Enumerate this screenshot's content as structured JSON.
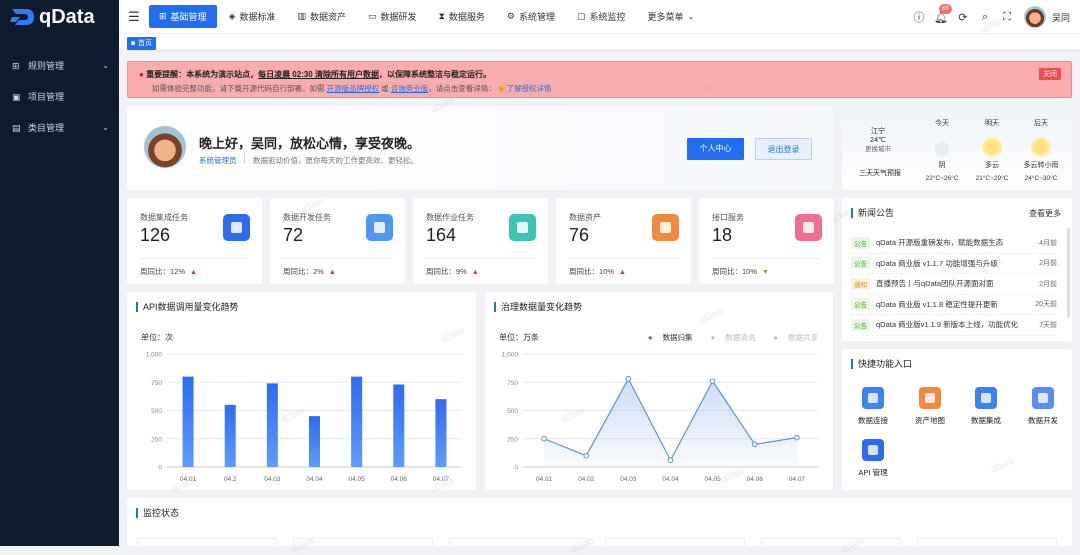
{
  "app": {
    "name": "qData"
  },
  "sidebar": {
    "items": [
      {
        "label": "规则管理",
        "icon": "grid-icon",
        "expandable": true
      },
      {
        "label": "项目管理",
        "icon": "folder-icon",
        "expandable": false
      },
      {
        "label": "类目管理",
        "icon": "category-icon",
        "expandable": true
      }
    ]
  },
  "topnav": {
    "items": [
      {
        "label": "基础管理",
        "icon": "grid-icon",
        "active": true
      },
      {
        "label": "数据标准",
        "icon": "layers-icon",
        "active": false
      },
      {
        "label": "数据资产",
        "icon": "chart-icon",
        "active": false
      },
      {
        "label": "数据研发",
        "icon": "window-icon",
        "active": false
      },
      {
        "label": "数据服务",
        "icon": "hourglass-icon",
        "active": false
      },
      {
        "label": "系统管理",
        "icon": "gear-icon",
        "active": false
      },
      {
        "label": "系统监控",
        "icon": "monitor-icon",
        "active": false
      },
      {
        "label": "更多菜单",
        "icon": "chevron-down-icon",
        "active": false
      }
    ],
    "notification_count": "68",
    "username": "吴同"
  },
  "tags": {
    "home": "首页"
  },
  "alert": {
    "title": "重要提醒：",
    "text": "本系统为演示站点，",
    "strong": "每日凌晨 02:30 清除所有用户数据",
    "text2": "，以保障系统整洁与稳定运行。",
    "line2a": "如需体验完整功能，请下载开源代码自行部署。如需",
    "link1": "开源版品牌授权",
    "or": " 或 ",
    "link2": "咨询商业版",
    "line2b": "，请点击查看详情：",
    "link3": "了解授权详情",
    "close": "关闭"
  },
  "welcome": {
    "greeting": "晚上好，吴同，放松心情，享受夜晚。",
    "role": "系统管理员",
    "motto": "数据驱动价值，愿你每天的工作更高效、更轻松。",
    "btn_profile": "个人中心",
    "btn_logout": "退出登录"
  },
  "weather": {
    "city": "江宁",
    "current_temp": "24℃",
    "switch_city": "更换城市",
    "forecast_title": "三天天气预报",
    "days": [
      {
        "day": "今天",
        "cond": "阴",
        "temp": "22°C~26°C",
        "icon": "cloud-icon"
      },
      {
        "day": "明天",
        "cond": "多云",
        "temp": "21°C~29°C",
        "icon": "sun-icon"
      },
      {
        "day": "后天",
        "cond": "多云转小雨",
        "temp": "24°C~30°C",
        "icon": "sun-icon"
      }
    ]
  },
  "stats": [
    {
      "label": "数据集成任务",
      "value": "126",
      "foot": "周同比：",
      "change": "12%",
      "trend": "up",
      "color": "#2f6bf0"
    },
    {
      "label": "数据开发任务",
      "value": "72",
      "foot": "周同比：",
      "change": "2%",
      "trend": "up",
      "color": "#4f97f2"
    },
    {
      "label": "数据作业任务",
      "value": "164",
      "foot": "周同比：",
      "change": "9%",
      "trend": "up",
      "color": "#3cc5b6"
    },
    {
      "label": "数据资产",
      "value": "76",
      "foot": "周同比：",
      "change": "10%",
      "trend": "up",
      "color": "#f08a3e"
    },
    {
      "label": "接口服务",
      "value": "18",
      "foot": "周同比：",
      "change": "10%",
      "trend": "down",
      "color": "#f26d8f"
    }
  ],
  "news": {
    "title": "新闻公告",
    "more": "查看更多",
    "items": [
      {
        "tag": "公告",
        "tag_type": "g",
        "title": "qData 开源版重磅发布，赋能数据生态",
        "date": "4月前"
      },
      {
        "tag": "公告",
        "tag_type": "g",
        "title": "qData 商业版 v1.1.7 功能增强与升级",
        "date": "2月前"
      },
      {
        "tag": "通知",
        "tag_type": "o",
        "title": "直播预告丨与qData团队开源面对面",
        "date": "2月前"
      },
      {
        "tag": "公告",
        "tag_type": "g",
        "title": "qData 商业版 v1.1.8 稳定性提升更新",
        "date": "20天前"
      },
      {
        "tag": "公告",
        "tag_type": "g",
        "title": "qData 商业版v1.1.9 新版本上线，功能优化",
        "date": "7天前"
      }
    ]
  },
  "quick": {
    "title": "快捷功能入口",
    "items": [
      {
        "label": "数据连接",
        "color": "#3b82f6"
      },
      {
        "label": "资产地图",
        "color": "#f08a3e"
      },
      {
        "label": "数据集成",
        "color": "#3b82f6"
      },
      {
        "label": "数据开发",
        "color": "#5b8def"
      },
      {
        "label": "API 管理",
        "color": "#2f6bf0"
      }
    ]
  },
  "chart_api": {
    "title": "API数据调用量变化趋势",
    "unit": "单位：次"
  },
  "chart_gov": {
    "title": "治理数据量变化趋势",
    "unit": "单位：万条",
    "legend": [
      "数据归集",
      "数据清洗",
      "数据共享"
    ]
  },
  "chart_data": [
    {
      "type": "bar",
      "title": "API数据调用量变化趋势",
      "categories": [
        "04.01",
        "04.2",
        "04.03",
        "04.04",
        "04.05",
        "04.06",
        "04.07"
      ],
      "values": [
        800,
        550,
        740,
        450,
        800,
        730,
        600
      ],
      "ylim": [
        0,
        1000
      ],
      "yticks": [
        "0",
        "250",
        "500",
        "750",
        "1,000"
      ],
      "color": "#2f6bf0"
    },
    {
      "type": "area",
      "title": "治理数据量变化趋势",
      "categories": [
        "04.01",
        "04.02",
        "04.03",
        "04.04",
        "04.05",
        "04.06",
        "04.07"
      ],
      "series": [
        {
          "name": "数据归集",
          "values": [
            250,
            100,
            780,
            60,
            760,
            200,
            260
          ]
        }
      ],
      "ylim": [
        0,
        1000
      ],
      "yticks": [
        "0",
        "250",
        "500",
        "750",
        "1,000"
      ],
      "color": "#5b8def"
    }
  ],
  "monitor": {
    "title": "监控状态"
  },
  "watermark": "qData"
}
